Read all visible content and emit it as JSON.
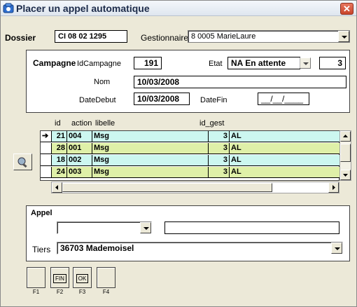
{
  "window": {
    "title": "Placer un appel automatique",
    "close_label": "✕"
  },
  "dossier": {
    "label": "Dossier",
    "value": "CI 08 02 1295"
  },
  "gestionnaire": {
    "label": "Gestionnaire",
    "value": "8 0005   MarieLaure"
  },
  "campagne": {
    "label": "Campagne",
    "id_label": "IdCampagne",
    "id_value": "191",
    "etat_label": "Etat",
    "etat_value": "NA   En attente",
    "etat_count": "3",
    "nom_label": "Nom",
    "nom_value": "10/03/2008",
    "datedebut_label": "DateDebut",
    "datedebut_value": "10/03/2008",
    "datefin_label": "DateFin",
    "datefin_value": "__/__/____"
  },
  "grid": {
    "headers": [
      "id",
      "action",
      "libelle",
      "id_gest"
    ],
    "rows": [
      {
        "id": "21",
        "action": "004",
        "libelle": "Msg",
        "id_gest": "3",
        "extra": "AL",
        "color": "#ccf7f0",
        "current": true
      },
      {
        "id": "28",
        "action": "001",
        "libelle": "Msg",
        "id_gest": "3",
        "extra": "AL",
        "color": "#dff0a8",
        "current": false
      },
      {
        "id": "18",
        "action": "002",
        "libelle": "Msg",
        "id_gest": "3",
        "extra": "AL",
        "color": "#ccf7f0",
        "current": false
      },
      {
        "id": "24",
        "action": "003",
        "libelle": "Msg",
        "id_gest": "3",
        "extra": "AL",
        "color": "#dff0a8",
        "current": false
      }
    ],
    "current_marker": "➔"
  },
  "appel": {
    "label": "Appel",
    "select_value": "",
    "text_value": ""
  },
  "tiers": {
    "label": "Tiers",
    "value": "36703  Mademoisel"
  },
  "function_keys": [
    {
      "caption": "",
      "key": "F1"
    },
    {
      "caption": "FIN",
      "key": "F2"
    },
    {
      "caption": "OK",
      "key": "F3"
    },
    {
      "caption": "",
      "key": "F4"
    }
  ],
  "colors": {
    "row_cyan": "#ccf7f0",
    "row_green": "#dff0a8",
    "title": "#1c2b4a",
    "close": "#c8442a"
  }
}
